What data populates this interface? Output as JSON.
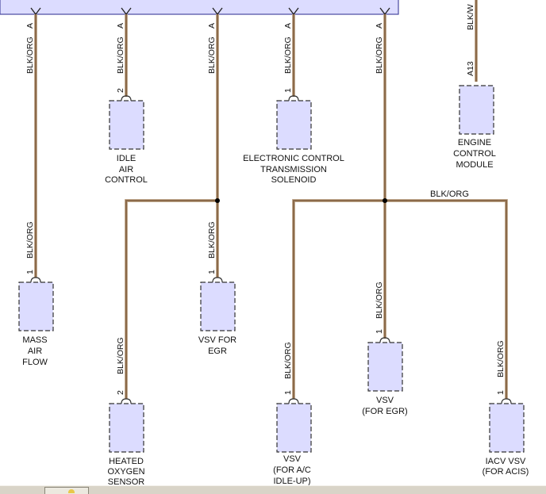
{
  "diagram": {
    "wire_color": "#8b6a4a",
    "component_fill": "#dcdcff",
    "wire_labels": {
      "maf_top": "BLK/ORG",
      "iac_top": "BLK/ORG",
      "egr_trunk_top": "BLK/ORG",
      "ect_top": "BLK/ORG",
      "right_trunk_top": "BLK/ORG",
      "ecm_top": "BLK/W",
      "maf_lower": "BLK/ORG",
      "vsv_egr_left": "BLK/ORG",
      "hos": "BLK/ORG",
      "vsv_ac": "BLK/ORG",
      "vsv_egr_right": "BLK/ORG",
      "iacv_vsv": "BLK/ORG",
      "horizontal_right": "BLK/ORG"
    },
    "connector_letters": {
      "maf": "A",
      "iac": "A",
      "egr_trunk": "A",
      "ect": "A",
      "right_trunk": "A"
    },
    "pins": {
      "iac": "2",
      "ect": "1",
      "ecm": "A13",
      "maf": "1",
      "vsv_egr_left": "1",
      "hos": "2",
      "vsv_ac": "1",
      "vsv_egr_right": "1",
      "iacv_vsv": "1"
    },
    "components": {
      "iac": [
        "IDLE",
        "AIR",
        "CONTROL"
      ],
      "ect": [
        "ELECTRONIC CONTROL",
        "TRANSMISSION",
        "SOLENOID"
      ],
      "ecm": [
        "ENGINE",
        "CONTROL",
        "MODULE"
      ],
      "maf": [
        "MASS",
        "AIR",
        "FLOW"
      ],
      "vsv_egr_left": [
        "VSV FOR",
        "EGR"
      ],
      "hos": [
        "HEATED",
        "OXYGEN",
        "SENSOR"
      ],
      "vsv_ac": [
        "VSV",
        "(FOR A/C",
        "IDLE-UP)"
      ],
      "vsv_egr_right": [
        "VSV",
        "(FOR EGR)"
      ],
      "iacv_vsv": [
        "IACV VSV",
        "(FOR ACIS)"
      ]
    }
  }
}
